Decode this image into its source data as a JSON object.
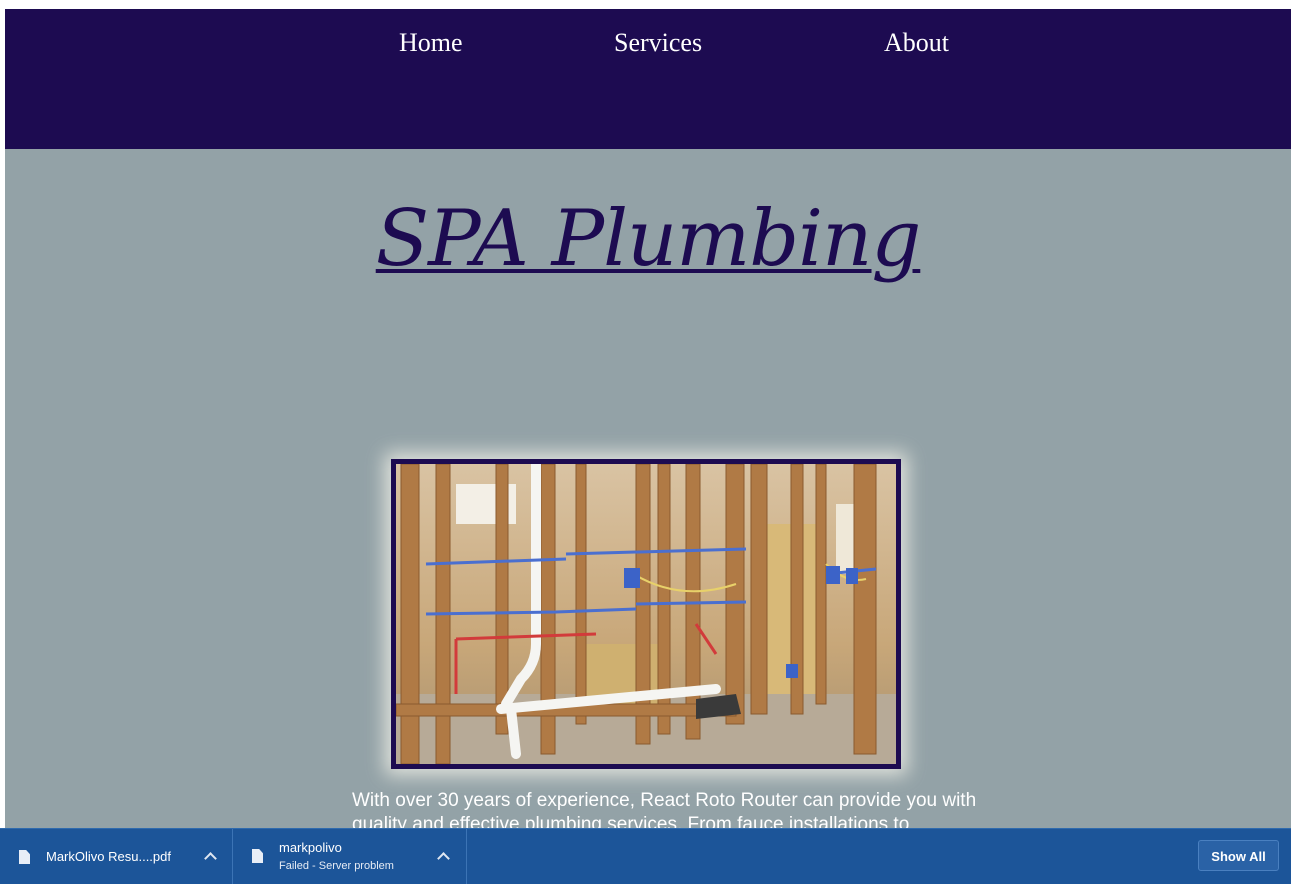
{
  "nav": {
    "home": "Home",
    "services": "Services",
    "about": "About"
  },
  "hero": {
    "title": "SPA Plumbing"
  },
  "intro": {
    "text": "With over 30 years of experience, React Roto Router can provide you with quality and effective plumbing services. From fauce installations to"
  },
  "downloads": {
    "items": [
      {
        "name": "MarkOlivo Resu....pdf",
        "status": ""
      },
      {
        "name": "markpolivo",
        "status": "Failed - Server problem"
      }
    ],
    "show_all": "Show All"
  },
  "colors": {
    "nav_background": "#1d0b51",
    "page_background": "#93a2a7",
    "download_bar": "#1c5599"
  },
  "icons": [
    "file-icon",
    "chevron-up-icon"
  ]
}
